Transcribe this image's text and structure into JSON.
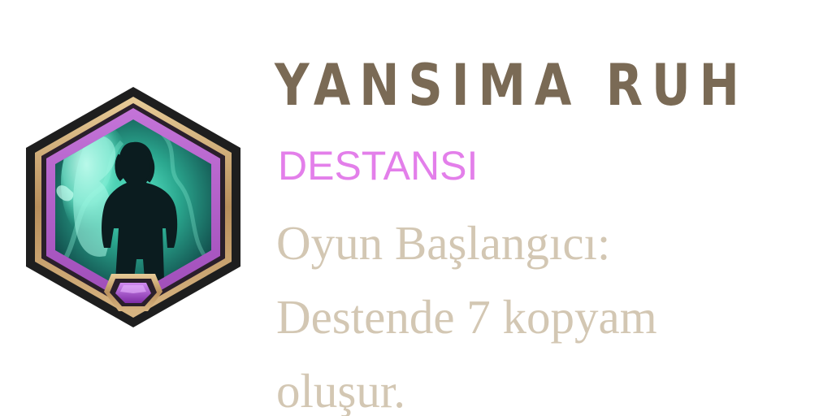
{
  "card": {
    "name": "YANSIMA RUH",
    "rarity": "DESTANSI",
    "description": "Oyun Başlangıcı: Destende 7 kopyam oluşur.",
    "portrait_icon": "spirit-reflection-portrait",
    "gem_icon": "epic-gem-icon"
  },
  "colors": {
    "name": "#7a6a55",
    "rarity": "#e37fea",
    "description": "#d3c7b3",
    "frame_outer": "#1e1e1e",
    "frame_gold": "#c9a575",
    "frame_purple": "#b464c8",
    "spirit_glow": "#4ee6c6"
  }
}
